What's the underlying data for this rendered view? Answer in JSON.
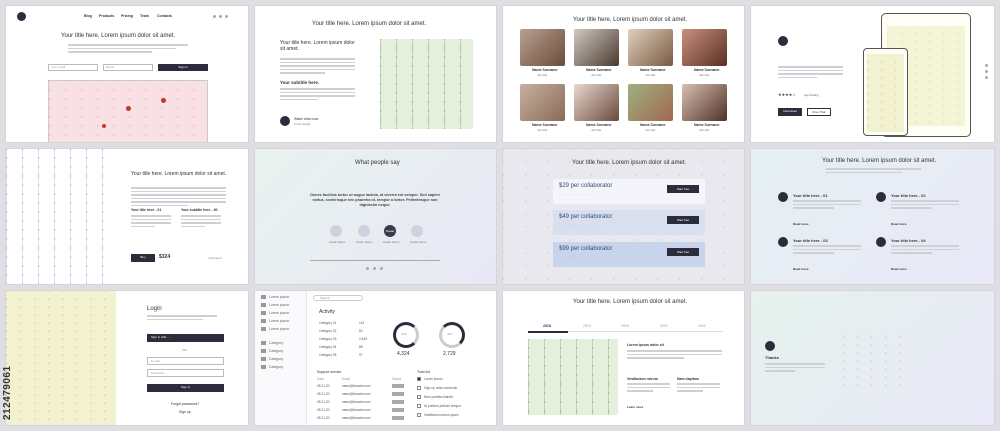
{
  "common": {
    "title": "Your title here. Lorem ipsum dolor sit amet.",
    "subtitle": "Your subtitle here.",
    "name": "Name Surname",
    "title_here_3": "Your title here - 3"
  },
  "s1": {
    "nav": [
      "Blog",
      "Products",
      "Pricing",
      "Team",
      "Contacts"
    ],
    "email_placeholder": "Your email",
    "name_placeholder": "Name",
    "signin": "Sign in"
  },
  "s2": {
    "title_short": "Your title here. Lorem ipsum dolor sit amet.",
    "watch": "Watch video now",
    "dur": "2 min length"
  },
  "s3": {
    "names": [
      "Name Surname",
      "Name Surname",
      "Name Surname",
      "Name Surname",
      "Name Surname",
      "Name Surname",
      "Name Surname",
      "Name Surname"
    ],
    "role": "Job title"
  },
  "s4": {
    "rating": "App Rating",
    "download": "Download",
    "trial": "Free Trial"
  },
  "s5": {
    "t1": "Your title here - 01",
    "t2": "Your subtitle here - 00",
    "price": "$324",
    "buy": "Buy",
    "rev": "4 Reviews"
  },
  "s6": {
    "title": "What people say",
    "quote": "Donec facilisis tortor ut augue lacinia, at viverra est semper. Sed sapien metus, scelerisque nec pharetra id, tempor a tortor. Pellentesque non dignissim neque.",
    "people": [
      "Avatar Name",
      "Avatar Name",
      "Avatar Name",
      "Avatar Name"
    ],
    "center_label": "Avatar"
  },
  "s7": {
    "plans": [
      {
        "price": "$29 per collaborator",
        "cta": "Start free"
      },
      {
        "price": "$49 per collaborator",
        "cta": "Start free"
      },
      {
        "price": "$99 per collaborator",
        "cta": "Start free"
      }
    ]
  },
  "s8": {
    "items": [
      "Your title here - 01",
      "Your title here - 02",
      "Your title here - 03",
      "Your title here - 04"
    ],
    "more": "Read more"
  },
  "s9": {
    "title": "Login",
    "signin_with": "Sign in with ...",
    "or": "OR",
    "email": "E-mail",
    "password": "Password",
    "signin": "Sign in",
    "forgot": "Forgot password?",
    "signup": "Sign up"
  },
  "s10": {
    "search": "Search",
    "side": [
      "Lorem ipsum",
      "Lorem ipsum",
      "Lorem ipsum",
      "Lorem ipsum",
      "Lorem ipsum",
      "Category",
      "Category",
      "Category",
      "Category"
    ],
    "activity": "Activity",
    "cats": [
      [
        "Category 01",
        "113"
      ],
      [
        "Category 02",
        "50"
      ],
      [
        "Category 03",
        "2,445"
      ],
      [
        "Category 04",
        "88"
      ],
      [
        "Category 05",
        "97"
      ]
    ],
    "stat1": "4,324",
    "stat2": "2,729",
    "pct1": "74.0",
    "pct2": "42.7",
    "support": "Support service",
    "cols": [
      "Date",
      "Email",
      "Status"
    ],
    "rows": [
      [
        "05.21.20",
        "name@domain.com"
      ],
      [
        "05.21.20",
        "name@domain.com"
      ],
      [
        "05.21.20",
        "name@domain.com"
      ],
      [
        "05.21.20",
        "name@domain.com"
      ],
      [
        "05.21.20",
        "name@domain.com"
      ]
    ],
    "todo": "Todo list",
    "todos": [
      "Lorem ipsum",
      "Sign up nulla commodo",
      "Nam porttitor blandit",
      "Ut pretium pretium tempor",
      "Vestibulum rutrum quam"
    ]
  },
  "s11": {
    "tabs": [
      "2018",
      "2019",
      "2020",
      "2021",
      "2022"
    ],
    "h1": "Lorem ipsum dolor sit",
    "h2": "Vestibulum rutrum",
    "h3": "Nam dapibus",
    "more": "Learn more"
  },
  "s12": {
    "thanks": "Thanks"
  },
  "stock_id": "212479061"
}
